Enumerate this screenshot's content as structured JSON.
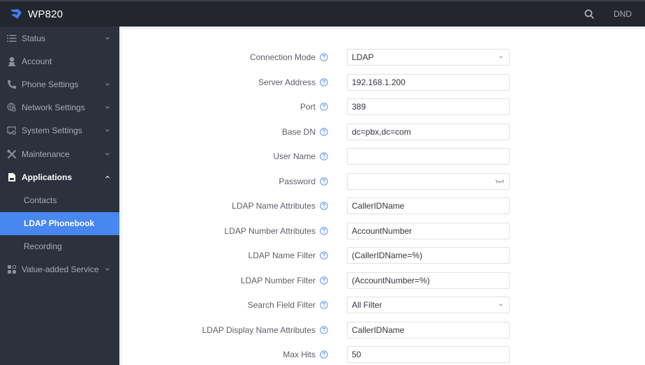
{
  "header": {
    "brand": "WP820",
    "search_icon": "search-icon",
    "dnd_label": "DND",
    "colors": {
      "bar": "#23262e",
      "logo": "#3d7ff2"
    }
  },
  "sidebar": {
    "items": [
      {
        "label": "Status",
        "icon": "list-icon",
        "expandable": true,
        "expanded": false
      },
      {
        "label": "Account",
        "icon": "user-icon",
        "expandable": false
      },
      {
        "label": "Phone Settings",
        "icon": "phone-icon",
        "expandable": true,
        "expanded": false
      },
      {
        "label": "Network Settings",
        "icon": "globe-gear-icon",
        "expandable": true,
        "expanded": false
      },
      {
        "label": "System Settings",
        "icon": "monitor-gear-icon",
        "expandable": true,
        "expanded": false
      },
      {
        "label": "Maintenance",
        "icon": "tools-icon",
        "expandable": true,
        "expanded": false
      },
      {
        "label": "Applications",
        "icon": "document-icon",
        "expandable": true,
        "expanded": true,
        "children": [
          {
            "label": "Contacts",
            "selected": false
          },
          {
            "label": "LDAP Phonebook",
            "selected": true
          },
          {
            "label": "Recording",
            "selected": false
          }
        ]
      },
      {
        "label": "Value-added Service",
        "icon": "apps-grid-icon",
        "expandable": true,
        "expanded": false
      }
    ],
    "colors": {
      "background": "#2d313d",
      "selected": "#4887f0",
      "text": "#a7abb5"
    }
  },
  "form": {
    "fields": [
      {
        "label": "Connection Mode",
        "type": "select",
        "value": "LDAP"
      },
      {
        "label": "Server Address",
        "type": "text",
        "value": "192.168.1.200"
      },
      {
        "label": "Port",
        "type": "text",
        "value": "389"
      },
      {
        "label": "Base DN",
        "type": "text",
        "value": "dc=pbx,dc=com"
      },
      {
        "label": "User Name",
        "type": "text",
        "value": ""
      },
      {
        "label": "Password",
        "type": "password",
        "value": ""
      },
      {
        "label": "LDAP Name Attributes",
        "type": "text",
        "value": "CallerIDName"
      },
      {
        "label": "LDAP Number Attributes",
        "type": "text",
        "value": "AccountNumber"
      },
      {
        "label": "LDAP Name Filter",
        "type": "text",
        "value": "(CallerIDName=%)"
      },
      {
        "label": "LDAP Number Filter",
        "type": "text",
        "value": "(AccountNumber=%)"
      },
      {
        "label": "Search Field Filter",
        "type": "select",
        "value": "All Filter"
      },
      {
        "label": "LDAP Display Name Attributes",
        "type": "text",
        "value": "CallerIDName"
      },
      {
        "label": "Max Hits",
        "type": "text",
        "value": "50"
      }
    ],
    "help_icon_color": "#4a86e8"
  }
}
